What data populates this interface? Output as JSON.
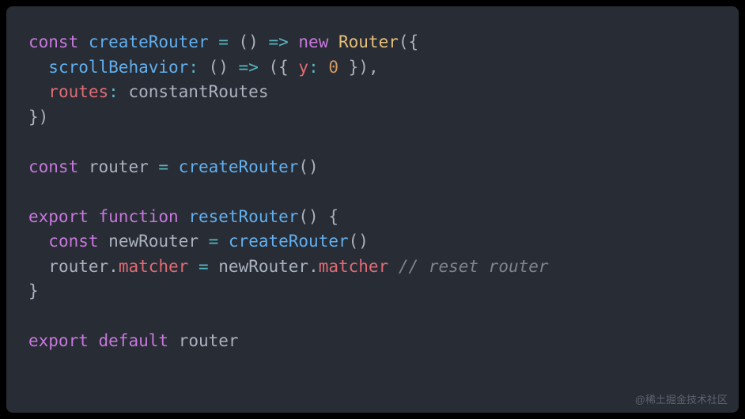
{
  "code": {
    "line1": {
      "const": "const",
      "createRouter": "createRouter",
      "eq": " = ",
      "parens": "()",
      "arrow": " => ",
      "new": "new",
      "Router": "Router",
      "open": "({"
    },
    "line2": {
      "indent": "  ",
      "scrollBehavior": "scrollBehavior",
      "colon": ": ",
      "parens": "()",
      "arrow": " => ",
      "openObj": "({ ",
      "y": "y",
      "colon2": ": ",
      "zero": "0",
      "closeObj": " }),"
    },
    "line3": {
      "indent": "  ",
      "routes": "routes",
      "colon": ": ",
      "constantRoutes": "constantRoutes"
    },
    "line4": {
      "close": "})"
    },
    "line6": {
      "const": "const",
      "router": "router",
      "eq": " = ",
      "createRouter": "createRouter",
      "parens": "()"
    },
    "line8": {
      "export": "export",
      "function": "function",
      "resetRouter": "resetRouter",
      "parens": "()",
      "brace": " {"
    },
    "line9": {
      "indent": "  ",
      "const": "const",
      "newRouter": "newRouter",
      "eq": " = ",
      "createRouter": "createRouter",
      "parens": "()"
    },
    "line10": {
      "indent": "  ",
      "router": "router",
      "dot1": ".",
      "matcher1": "matcher",
      "eq": " = ",
      "newRouter": "newRouter",
      "dot2": ".",
      "matcher2": "matcher",
      "space": " ",
      "comment": "// reset router"
    },
    "line11": {
      "close": "}"
    },
    "line13": {
      "export": "export",
      "default": "default",
      "router": "router"
    }
  },
  "watermark": "@稀土掘金技术社区"
}
